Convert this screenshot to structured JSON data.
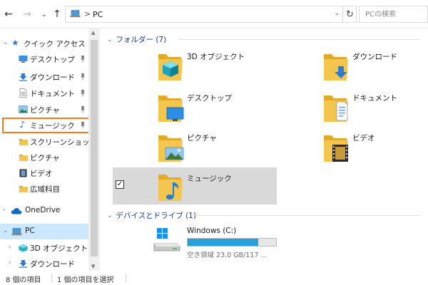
{
  "address_bar": {
    "back_icon": "arrow-left-icon",
    "forward_icon": "arrow-right-icon",
    "recent_icon": "chevron-down-icon",
    "up_icon": "arrow-up-icon",
    "separator": ">",
    "path": "PC",
    "refresh_icon": "refresh-icon",
    "search_placeholder": "PCの検索"
  },
  "nav_pane": {
    "quick_access": "クイック アクセス",
    "items": [
      {
        "label": "デスクトップ",
        "icon": "desktop-folder-icon",
        "pinned": true
      },
      {
        "label": "ダウンロード",
        "icon": "download-folder-icon",
        "pinned": true
      },
      {
        "label": "ドキュメント",
        "icon": "documents-folder-icon",
        "pinned": true
      },
      {
        "label": "ピクチャ",
        "icon": "pictures-folder-icon",
        "pinned": true
      },
      {
        "label": "ミュージック",
        "icon": "music-folder-icon",
        "pinned": true
      },
      {
        "label": "スクリーンショット",
        "icon": "folder-icon",
        "pinned": false
      },
      {
        "label": "ピクチャ",
        "icon": "pictures-folder-icon",
        "pinned": false
      },
      {
        "label": "ビデオ",
        "icon": "videos-folder-icon",
        "pinned": false
      },
      {
        "label": "広域科目",
        "icon": "folder-icon",
        "pinned": false
      }
    ],
    "onedrive": "OneDrive",
    "pc": "PC",
    "pc_children": [
      {
        "label": "3D オブジェクト",
        "icon": "3d-objects-icon"
      },
      {
        "label": "ダウンロード",
        "icon": "download-folder-icon"
      }
    ]
  },
  "content": {
    "folders_header": "フォルダー (7)",
    "folders": [
      {
        "label": "3D オブジェクト",
        "icon": "3d-objects-icon"
      },
      {
        "label": "ダウンロード",
        "icon": "download-folder-icon"
      },
      {
        "label": "デスクトップ",
        "icon": "desktop-folder-icon"
      },
      {
        "label": "ドキュメント",
        "icon": "documents-folder-icon"
      },
      {
        "label": "ピクチャ",
        "icon": "pictures-folder-icon"
      },
      {
        "label": "ビデオ",
        "icon": "videos-folder-icon"
      },
      {
        "label": "ミュージック",
        "icon": "music-folder-icon",
        "selected": true
      }
    ],
    "drives_header": "デバイスとドライブ (1)",
    "drive": {
      "name": "Windows (C:)",
      "space": "空き領域 23.0 GB/117 ...",
      "used_fraction": 0.8
    }
  },
  "status_bar": {
    "item_count": "8 個の項目",
    "selection": "1 個の項目を選択"
  },
  "colors": {
    "accent_blue": "#26a0da",
    "selection_highlight": "#cce8ff",
    "tile_selected": "#d9d9d9",
    "annotation_box": "#f07b1f",
    "folder_yellow": "#f5c64f"
  }
}
